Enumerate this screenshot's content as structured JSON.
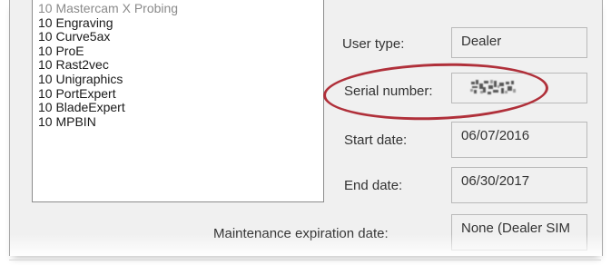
{
  "products_list": {
    "items": [
      "10 Mastercam X Probing",
      "10 Engraving",
      "10 Curve5ax",
      "10 ProE",
      "10 Rast2vec",
      "10 Unigraphics",
      "10 PortExpert",
      "10 BladeExpert",
      "10 MPBIN"
    ]
  },
  "user_type": {
    "label": "User type:",
    "value": "Dealer"
  },
  "serial_number": {
    "label": "Serial number:",
    "value": ""
  },
  "start_date": {
    "label": "Start date:",
    "value": "06/07/2016"
  },
  "end_date": {
    "label": "End date:",
    "value": "06/30/2017"
  },
  "maintenance": {
    "label": "Maintenance expiration date:",
    "value": "None (Dealer SIM"
  },
  "colors": {
    "highlight": "#b0303a",
    "panel": "#f0f0f0"
  }
}
